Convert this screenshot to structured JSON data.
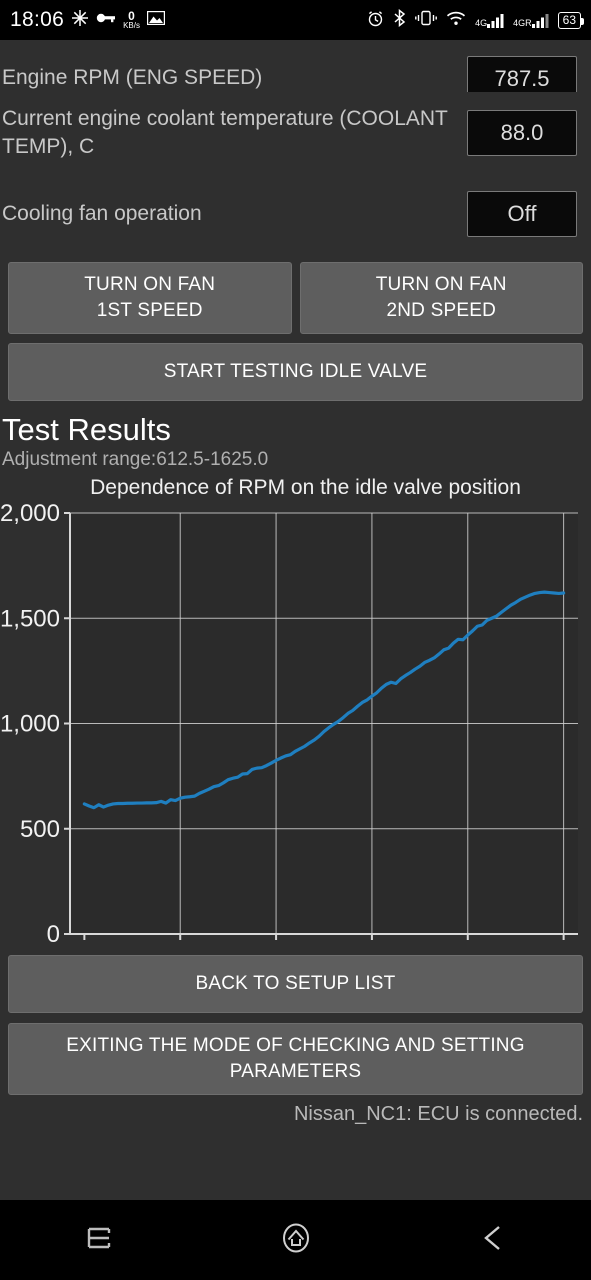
{
  "status_bar": {
    "time": "18:06",
    "icons_left": [
      "flash-icon",
      "vpn-key-icon",
      "gallery-icon"
    ],
    "net_speed_value": "0",
    "net_speed_unit": "KB/s",
    "icons_right": [
      "alarm-icon",
      "bluetooth-icon",
      "vibrate-icon",
      "wifi-icon",
      "signal-4g-icon",
      "signal-4gr-icon"
    ],
    "signal_label_1": "4G",
    "signal_label_2": "4GR",
    "battery_percent": "63"
  },
  "params": [
    {
      "label": "Engine RPM (ENG SPEED)",
      "value": "787.5"
    },
    {
      "label": "Current engine coolant temperature (COOLANT TEMP), C",
      "value": "88.0"
    },
    {
      "label": "Cooling fan operation",
      "value": "Off"
    }
  ],
  "actions": {
    "fan_1st_line1": "TURN ON FAN",
    "fan_1st_line2": "1ST SPEED",
    "fan_2nd_line1": "TURN ON FAN",
    "fan_2nd_line2": "2ND SPEED",
    "start_test": "START TESTING IDLE VALVE"
  },
  "results": {
    "heading": "Test Results",
    "adjustment_range": "Adjustment range:612.5-1625.0"
  },
  "footer": {
    "back_button": "BACK TO SETUP LIST",
    "exit_line1": "EXITING THE MODE OF CHECKING AND SETTING",
    "exit_line2": "PARAMETERS",
    "connection_status": "Nissan_NC1: ECU is connected."
  },
  "nav_bar": {
    "recents": "recents-icon",
    "home": "home-icon",
    "back": "back-icon"
  },
  "colors": {
    "line": "#1f7fc0",
    "background": "#2f2f2f",
    "plot_background": "#2b2b2b",
    "grid": "#d0d0d0",
    "button": "#5e5e5e"
  },
  "chart_data": {
    "type": "line",
    "title": "Dependence of RPM on the idle valve position",
    "xlabel": "",
    "ylabel": "",
    "xlim": [
      -3,
      103
    ],
    "ylim": [
      0,
      2000
    ],
    "xticks": [
      0,
      20,
      40,
      60,
      80,
      100
    ],
    "ytick_labels": [
      "0",
      "500",
      "1,000",
      "1,500",
      "2,000"
    ],
    "yticks": [
      0,
      500,
      1000,
      1500,
      2000
    ],
    "grid": true,
    "legend": "none",
    "series": [
      {
        "name": "RPM",
        "x": [
          0,
          1,
          2,
          3,
          4,
          5,
          6,
          7,
          8,
          9,
          10,
          11,
          12,
          13,
          14,
          15,
          16,
          17,
          18,
          19,
          20,
          21,
          22,
          23,
          24,
          25,
          26,
          27,
          28,
          29,
          30,
          31,
          32,
          33,
          34,
          35,
          36,
          37,
          38,
          39,
          40,
          41,
          42,
          43,
          44,
          45,
          46,
          47,
          48,
          49,
          50,
          51,
          52,
          53,
          54,
          55,
          56,
          57,
          58,
          59,
          60,
          61,
          62,
          63,
          64,
          65,
          66,
          67,
          68,
          69,
          70,
          71,
          72,
          73,
          74,
          75,
          76,
          77,
          78,
          79,
          80,
          81,
          82,
          83,
          84,
          85,
          86,
          87,
          88,
          89,
          90,
          91,
          92,
          93,
          94,
          95,
          96,
          97,
          98,
          99,
          100
        ],
        "values": [
          618,
          608,
          600,
          614,
          603,
          612,
          618,
          620,
          620,
          621,
          621,
          622,
          622,
          623,
          623,
          624,
          630,
          622,
          638,
          634,
          645,
          650,
          652,
          655,
          668,
          678,
          688,
          700,
          705,
          718,
          733,
          740,
          745,
          760,
          762,
          782,
          788,
          790,
          800,
          812,
          825,
          836,
          846,
          852,
          868,
          880,
          892,
          908,
          922,
          940,
          962,
          980,
          996,
          1010,
          1028,
          1048,
          1062,
          1082,
          1100,
          1112,
          1130,
          1146,
          1168,
          1186,
          1196,
          1190,
          1212,
          1228,
          1242,
          1258,
          1272,
          1290,
          1300,
          1312,
          1330,
          1350,
          1358,
          1382,
          1400,
          1398,
          1420,
          1440,
          1462,
          1468,
          1490,
          1500,
          1510,
          1528,
          1545,
          1562,
          1575,
          1590,
          1600,
          1610,
          1618,
          1622,
          1624,
          1622,
          1620,
          1618,
          1620,
          1624
        ]
      }
    ]
  }
}
